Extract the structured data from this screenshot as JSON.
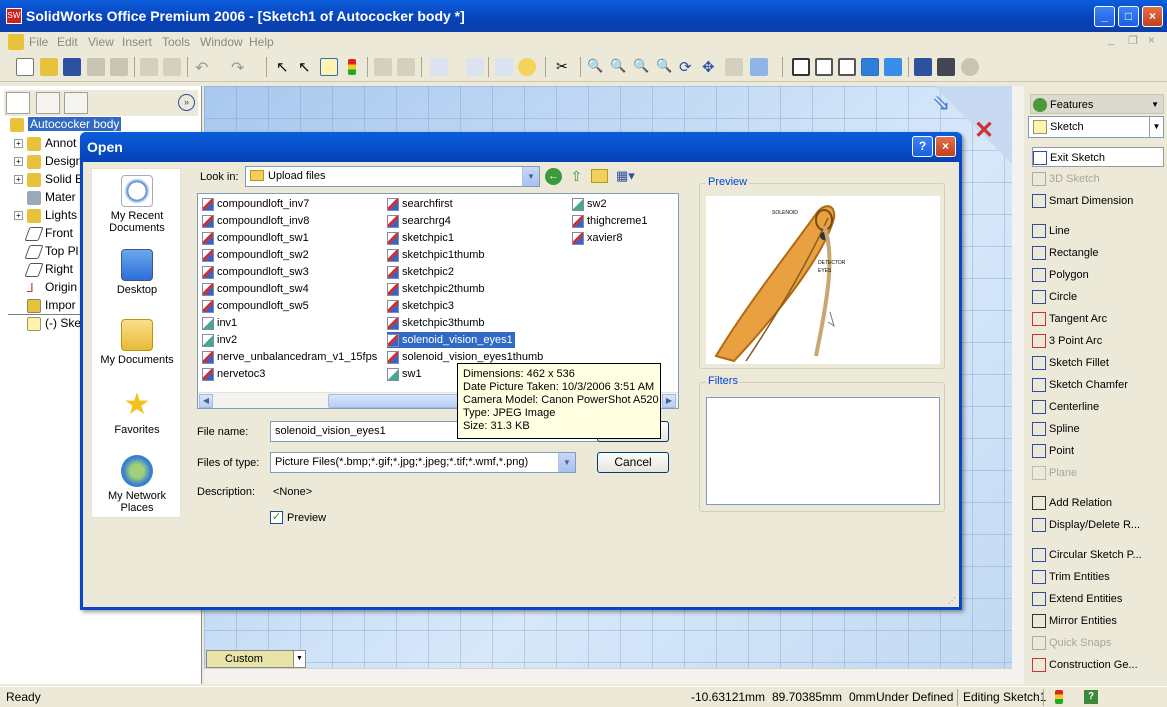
{
  "window": {
    "title": "SolidWorks Office Premium 2006 - [Sketch1 of Autococker body *]",
    "app_icon": "SW"
  },
  "menu": [
    "File",
    "Edit",
    "View",
    "Insert",
    "Tools",
    "Window",
    "Help"
  ],
  "tree": {
    "root": "Autococker body",
    "items": [
      "Annot",
      "Design",
      "Solid B",
      "Mater",
      "Lights",
      "Front",
      "Top Pl",
      "Right",
      "Origin",
      "Impor",
      "(-) Ske"
    ]
  },
  "command_manager": {
    "features_label": "Features",
    "sketch_label": "Sketch",
    "commands": [
      {
        "label": "Exit Sketch",
        "enabled": true
      },
      {
        "label": "3D Sketch",
        "enabled": false
      },
      {
        "label": "Smart Dimension",
        "enabled": true
      },
      {
        "label": "Line",
        "enabled": true
      },
      {
        "label": "Rectangle",
        "enabled": true
      },
      {
        "label": "Polygon",
        "enabled": true
      },
      {
        "label": "Circle",
        "enabled": true
      },
      {
        "label": "Tangent Arc",
        "enabled": true
      },
      {
        "label": "3 Point Arc",
        "enabled": true
      },
      {
        "label": "Sketch Fillet",
        "enabled": true
      },
      {
        "label": "Sketch Chamfer",
        "enabled": true
      },
      {
        "label": "Centerline",
        "enabled": true
      },
      {
        "label": "Spline",
        "enabled": true
      },
      {
        "label": "Point",
        "enabled": true
      },
      {
        "label": "Plane",
        "enabled": false
      },
      {
        "label": "Add Relation",
        "enabled": true
      },
      {
        "label": "Display/Delete R...",
        "enabled": true
      },
      {
        "label": "Circular Sketch P...",
        "enabled": true
      },
      {
        "label": "Trim Entities",
        "enabled": true
      },
      {
        "label": "Extend Entities",
        "enabled": true
      },
      {
        "label": "Mirror Entities",
        "enabled": true
      },
      {
        "label": "Quick Snaps",
        "enabled": false
      },
      {
        "label": "Construction Ge...",
        "enabled": true
      }
    ]
  },
  "viewport": {
    "custom_label": "Custom"
  },
  "status": {
    "ready": "Ready",
    "x": "-10.63121mm",
    "y": "89.70385mm",
    "z": "0mm",
    "state": "Under Defined",
    "mode": "Editing Sketch1"
  },
  "dialog": {
    "title": "Open",
    "look_in_label": "Look in:",
    "look_in_value": "Upload files",
    "places": [
      "My Recent Documents",
      "Desktop",
      "My Documents",
      "Favorites",
      "My Network Places"
    ],
    "files": [
      {
        "name": "compoundloft_inv7",
        "kind": "img"
      },
      {
        "name": "compoundloft_inv8",
        "kind": "img"
      },
      {
        "name": "compoundloft_sw1",
        "kind": "img"
      },
      {
        "name": "compoundloft_sw2",
        "kind": "img"
      },
      {
        "name": "compoundloft_sw3",
        "kind": "img"
      },
      {
        "name": "compoundloft_sw4",
        "kind": "img"
      },
      {
        "name": "compoundloft_sw5",
        "kind": "img"
      },
      {
        "name": "inv1",
        "kind": "sld"
      },
      {
        "name": "inv2",
        "kind": "sld"
      },
      {
        "name": "nerve_unbalancedram_v1_15fps",
        "kind": "img"
      },
      {
        "name": "nervetoc3",
        "kind": "img"
      },
      {
        "name": "searchfirst",
        "kind": "img"
      },
      {
        "name": "searchrg4",
        "kind": "img"
      },
      {
        "name": "sketchpic1",
        "kind": "img"
      },
      {
        "name": "sketchpic1thumb",
        "kind": "img"
      },
      {
        "name": "sketchpic2",
        "kind": "img"
      },
      {
        "name": "sketchpic2thumb",
        "kind": "img"
      },
      {
        "name": "sketchpic3",
        "kind": "img"
      },
      {
        "name": "sketchpic3thumb",
        "kind": "img"
      },
      {
        "name": "solenoid_vision_eyes1",
        "kind": "img",
        "selected": true
      },
      {
        "name": "solenoid_vision_eyes1thumb",
        "kind": "img"
      },
      {
        "name": "sw1",
        "kind": "sld"
      },
      {
        "name": "sw2",
        "kind": "sld"
      },
      {
        "name": "thighcreme1",
        "kind": "img"
      },
      {
        "name": "xavier8",
        "kind": "img"
      }
    ],
    "file_name_label": "File name:",
    "file_name_value": "solenoid_vision_eyes1",
    "file_type_label": "Files of type:",
    "file_type_value": "Picture Files(*.bmp;*.gif;*.jpg;*.jpeg;*.tif;*.wmf,*.png)",
    "description_label": "Description:",
    "description_value": "<None>",
    "preview_checkbox_label": "Preview",
    "preview_checked": true,
    "preview_group_label": "Preview",
    "filters_group_label": "Filters",
    "cancel_label": "Cancel",
    "preview_annotations": [
      "SOLENOID",
      "DETECTOR",
      "EYES"
    ]
  },
  "tooltip": [
    "Dimensions: 462 x 536",
    "Date Picture Taken: 10/3/2006 3:51 AM",
    "Camera Model: Canon PowerShot A520",
    "Type: JPEG Image",
    "Size: 31.3 KB"
  ],
  "colors": {
    "titlebar": "#0a5ddc",
    "selection": "#316ac5",
    "dialog_bg": "#ece9d8"
  }
}
